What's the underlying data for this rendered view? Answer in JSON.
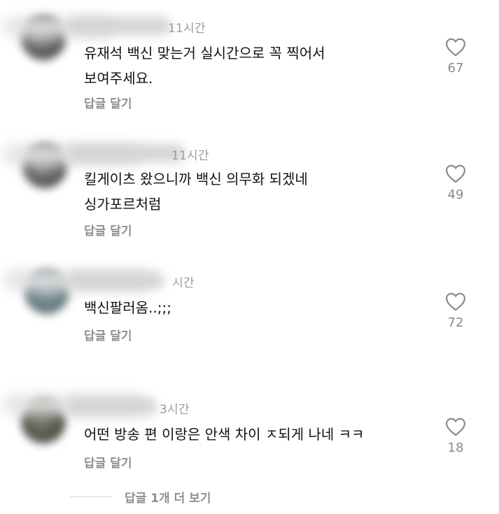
{
  "comments": [
    {
      "time": "11시간",
      "text": "유재석 백신 맞는거 실시간으로 꼭 찍어서\n보여주세요.",
      "reply": "답글 달기",
      "likes": "67",
      "like_icon": "heart-outline-icon"
    },
    {
      "time": "11시간",
      "text": "킬게이츠 왔으니까 백신 의무화 되겠네\n싱가포르처럼",
      "reply": "답글 달기",
      "likes": "49",
      "like_icon": "heart-outline-icon"
    },
    {
      "time": "시간",
      "text": "백신팔러옴..;;;",
      "reply": "답글 달기",
      "likes": "72",
      "like_icon": "heart-outline-icon"
    },
    {
      "time": "3시간",
      "text": "어떤 방송 편 이랑은 안색 차이 ㅈ되게 나네 ㅋㅋ",
      "reply": "답글 달기",
      "likes": "18",
      "like_icon": "heart-outline-icon"
    }
  ],
  "more_replies": "답글 1개 더 보기",
  "colors": {
    "text": "#111111",
    "muted": "#8f8f8f",
    "background": "#ffffff"
  }
}
